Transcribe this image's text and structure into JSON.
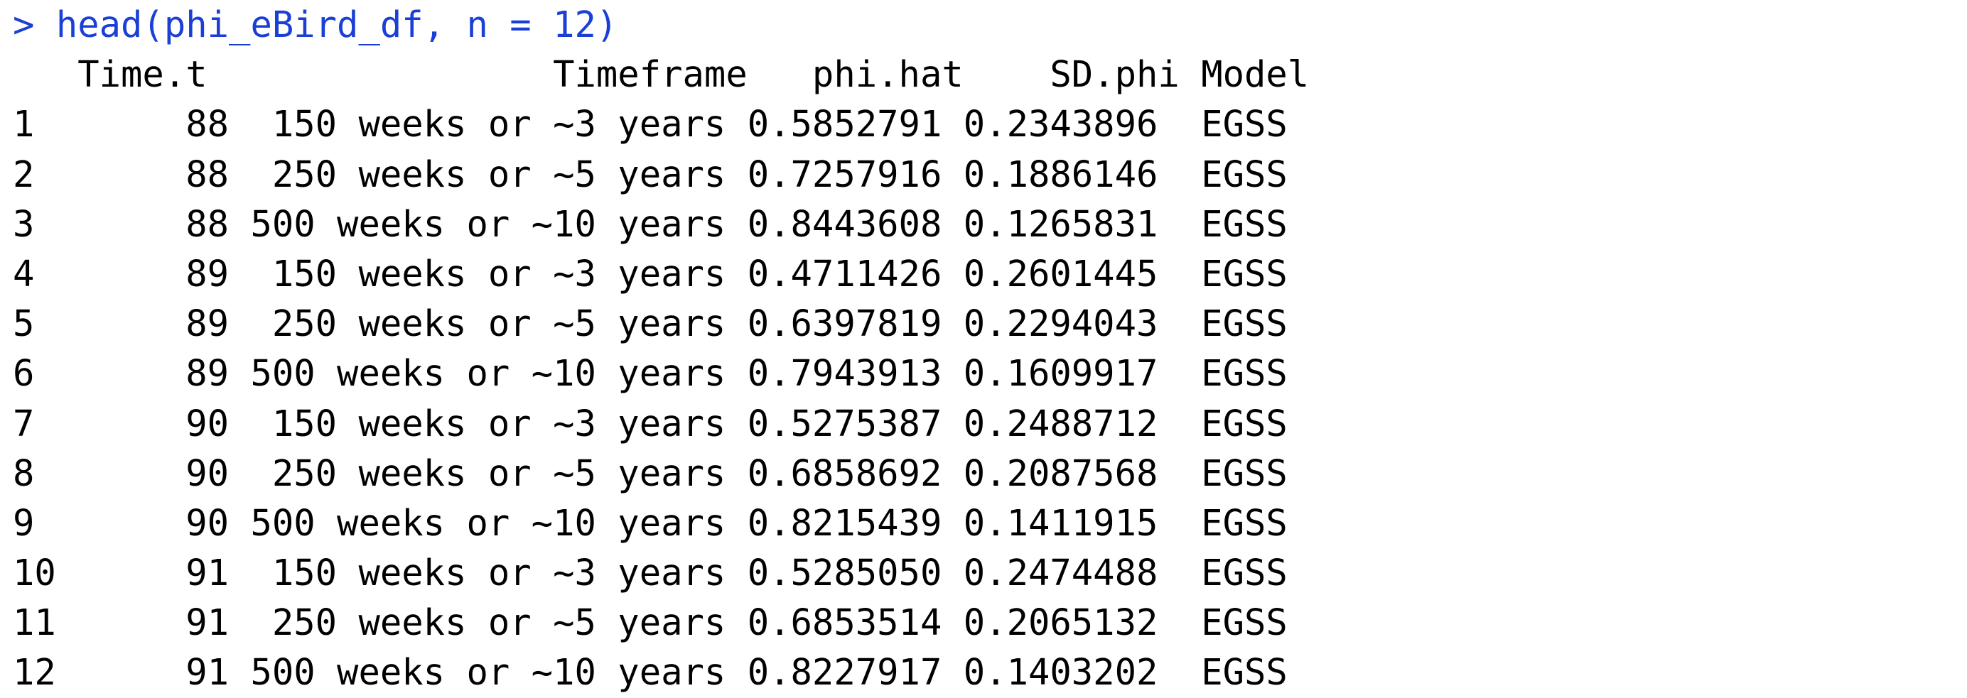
{
  "console": {
    "prompt_symbol": ">",
    "command": "head(phi_eBird_df, n = 12)",
    "header": "   Time.t                Timeframe   phi.hat    SD.phi Model",
    "rows": [
      "1       88  150 weeks or ~3 years 0.5852791 0.2343896  EGSS",
      "2       88  250 weeks or ~5 years 0.7257916 0.1886146  EGSS",
      "3       88 500 weeks or ~10 years 0.8443608 0.1265831  EGSS",
      "4       89  150 weeks or ~3 years 0.4711426 0.2601445  EGSS",
      "5       89  250 weeks or ~5 years 0.6397819 0.2294043  EGSS",
      "6       89 500 weeks or ~10 years 0.7943913 0.1609917  EGSS",
      "7       90  150 weeks or ~3 years 0.5275387 0.2488712  EGSS",
      "8       90  250 weeks or ~5 years 0.6858692 0.2087568  EGSS",
      "9       90 500 weeks or ~10 years 0.8215439 0.1411915  EGSS",
      "10      91  150 weeks or ~3 years 0.5285050 0.2474488  EGSS",
      "11      91  250 weeks or ~5 years 0.6853514 0.2065132  EGSS",
      "12      91 500 weeks or ~10 years 0.8227917 0.1403202  EGSS"
    ]
  },
  "colors": {
    "prompt": "#1a3fd6",
    "output": "#000000",
    "background": "#ffffff"
  }
}
